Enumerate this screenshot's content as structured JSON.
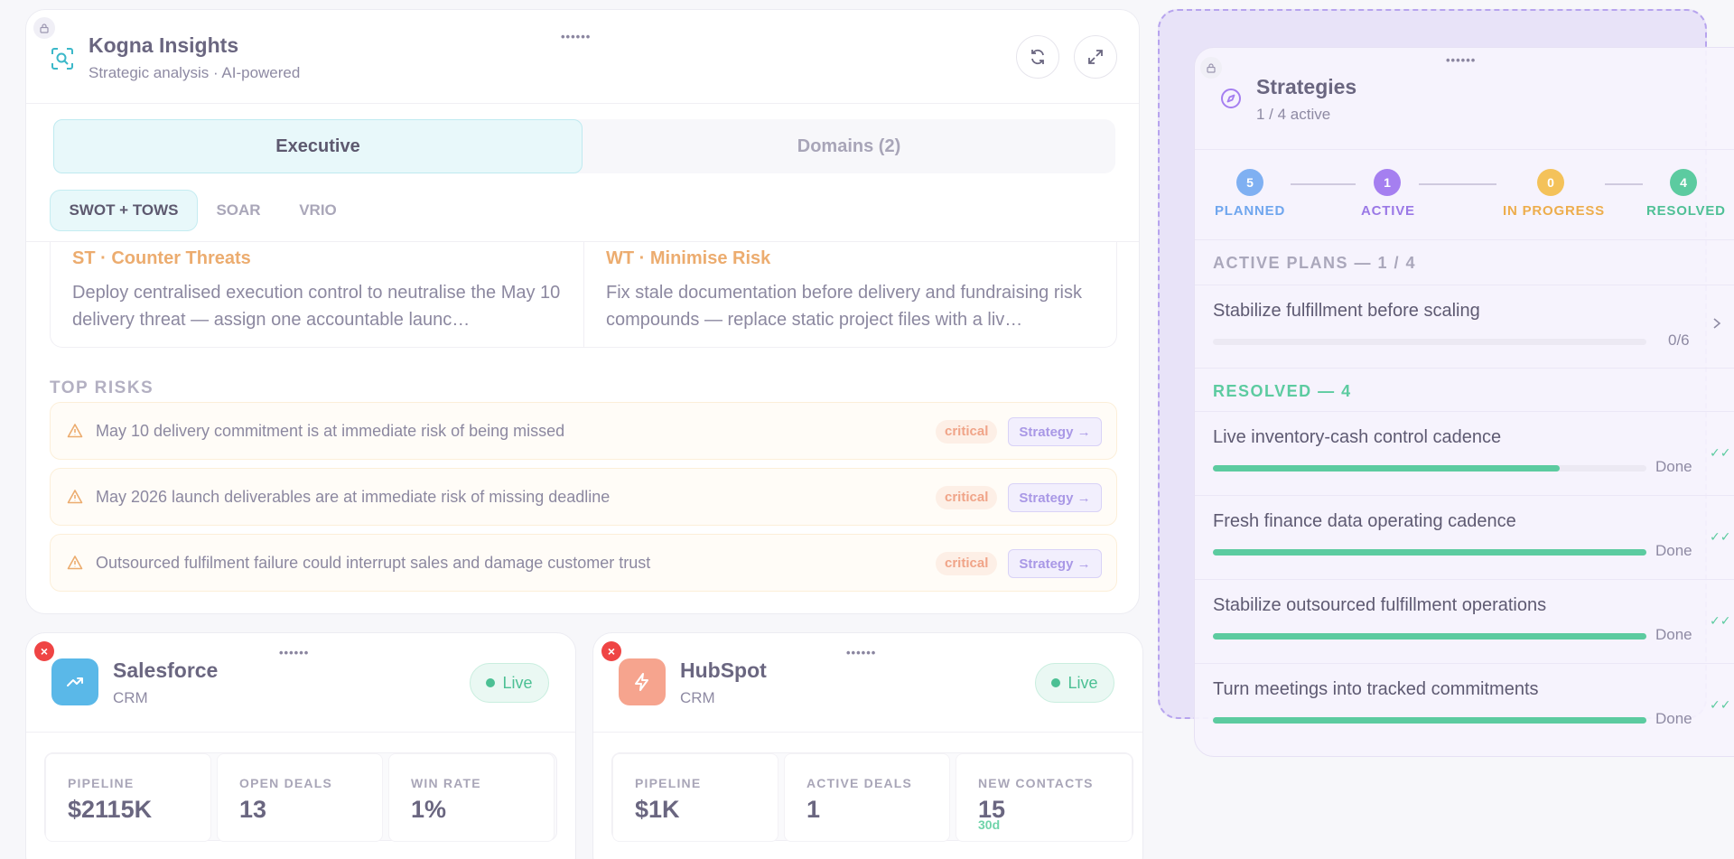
{
  "insights": {
    "title": "Kogna Insights",
    "subtitle": "Strategic analysis · AI-powered",
    "drag_handle": "••••••",
    "tabs": [
      {
        "label": "Executive",
        "active": true
      },
      {
        "label": "Domains (2)",
        "active": false
      }
    ],
    "subtabs": [
      {
        "label": "SWOT + TOWS",
        "active": true
      },
      {
        "label": "SOAR",
        "active": false
      },
      {
        "label": "VRIO",
        "active": false
      }
    ],
    "tows": [
      {
        "heading": "ST · Counter Threats",
        "text": "Deploy centralised execution control to neutralise the May 10 delivery threat — assign one accountable launc…"
      },
      {
        "heading": "WT · Minimise Risk",
        "text": "Fix stale documentation before delivery and fundraising risk compounds — replace static project files with a liv…"
      }
    ],
    "top_risks_title": "TOP RISKS",
    "risks": [
      {
        "text": "May 10 delivery commitment is at immediate risk of being missed",
        "severity": "critical",
        "action": "Strategy →"
      },
      {
        "text": "May 2026 launch deliverables are at immediate risk of missing deadline",
        "severity": "critical",
        "action": "Strategy →"
      },
      {
        "text": "Outsourced fulfilment failure could interrupt sales and damage customer trust",
        "severity": "critical",
        "action": "Strategy →"
      }
    ]
  },
  "crm_cards": [
    {
      "name": "Salesforce",
      "type": "CRM",
      "status": "Live",
      "drag_handle": "••••••",
      "remove": "×",
      "stats": [
        {
          "label": "PIPELINE",
          "value": "$2115K",
          "sub": ""
        },
        {
          "label": "OPEN DEALS",
          "value": "13",
          "sub": ""
        },
        {
          "label": "WIN RATE",
          "value": "1%",
          "sub": ""
        }
      ]
    },
    {
      "name": "HubSpot",
      "type": "CRM",
      "status": "Live",
      "drag_handle": "••••••",
      "remove": "×",
      "stats": [
        {
          "label": "PIPELINE",
          "value": "$1K",
          "sub": ""
        },
        {
          "label": "ACTIVE DEALS",
          "value": "1",
          "sub": ""
        },
        {
          "label": "NEW CONTACTS",
          "value": "15",
          "sub": "30d"
        }
      ]
    }
  ],
  "strategies": {
    "title": "Strategies",
    "subtitle": "1 / 4 active",
    "drag_handle": "••••••",
    "steps": [
      {
        "count": "5",
        "label": "PLANNED",
        "color": "#7fb0f2",
        "text_color": "#6fa6ee"
      },
      {
        "count": "1",
        "label": "ACTIVE",
        "color": "#a57ff0",
        "text_color": "#9a78e6"
      },
      {
        "count": "0",
        "label": "IN PROGRESS",
        "color": "#f4c25a",
        "text_color": "#edad4c"
      },
      {
        "count": "4",
        "label": "RESOLVED",
        "color": "#5ccba0",
        "text_color": "#4fc096"
      }
    ],
    "active_header": "ACTIVE PLANS — 1 / 4",
    "active_plans": [
      {
        "title": "Stabilize fulfillment before scaling",
        "progress": 0.0,
        "right": "0/6"
      }
    ],
    "resolved_header": "RESOLVED — 4",
    "resolved_plans": [
      {
        "title": "Live inventory-cash control cadence",
        "progress": 0.8,
        "right": "Done"
      },
      {
        "title": "Fresh finance data operating cadence",
        "progress": 1.0,
        "right": "Done"
      },
      {
        "title": "Stabilize outsourced fulfillment operations",
        "progress": 1.0,
        "right": "Done"
      },
      {
        "title": "Turn meetings into tracked commitments",
        "progress": 1.0,
        "right": "Done"
      }
    ]
  },
  "colors": {
    "accent_teal": "#3bb8c9",
    "warning": "#ecac6f",
    "critical": "#f0a488",
    "strategy": "#a998e6",
    "success": "#5ccba0",
    "salesforce": "#5ab8e8",
    "hubspot": "#f6a48e"
  }
}
